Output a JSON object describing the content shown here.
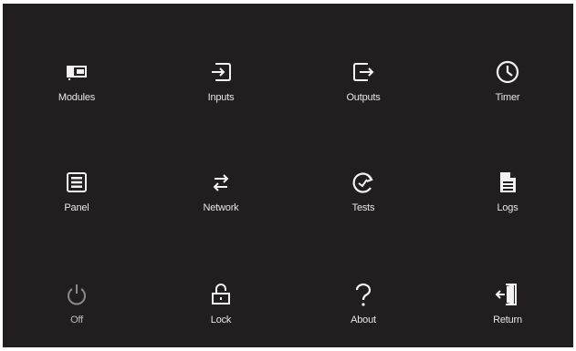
{
  "menu": {
    "items": [
      {
        "label": "Modules",
        "icon": "module-card-icon",
        "enabled": true
      },
      {
        "label": "Inputs",
        "icon": "input-arrow-icon",
        "enabled": true
      },
      {
        "label": "Outputs",
        "icon": "output-arrow-icon",
        "enabled": true
      },
      {
        "label": "Timer",
        "icon": "clock-icon",
        "enabled": true
      },
      {
        "label": "Panel",
        "icon": "panel-list-icon",
        "enabled": true
      },
      {
        "label": "Network",
        "icon": "exchange-arrows-icon",
        "enabled": true
      },
      {
        "label": "Tests",
        "icon": "refresh-check-icon",
        "enabled": true
      },
      {
        "label": "Logs",
        "icon": "document-icon",
        "enabled": true
      },
      {
        "label": "Off",
        "icon": "power-icon",
        "enabled": false
      },
      {
        "label": "Lock",
        "icon": "lock-icon",
        "enabled": true
      },
      {
        "label": "About",
        "icon": "question-icon",
        "enabled": true
      },
      {
        "label": "Return",
        "icon": "exit-door-icon",
        "enabled": true
      }
    ]
  },
  "colors": {
    "background": "#221e1f",
    "icon": "#f2f2f2",
    "icon_disabled": "#8a8a8a",
    "label": "#e6e6e6"
  }
}
